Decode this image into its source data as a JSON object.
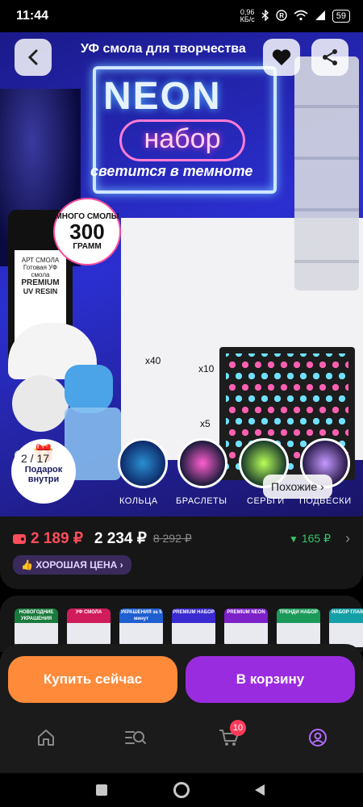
{
  "status_bar": {
    "time": "11:44",
    "net_speed_value": "0,96",
    "net_speed_unit": "КБ/с",
    "battery": "59",
    "icons": [
      "bluetooth-icon",
      "registered-icon",
      "wifi-icon",
      "signal-icon",
      "battery-icon"
    ]
  },
  "hero": {
    "title": "УФ смола для творчества",
    "neon_word": "NEON",
    "nabor_word": "набор",
    "glows_text": "светится в темноте",
    "bottle_label_top": "АРТ СМОЛА",
    "bottle_label_lines": [
      "Готовая УФ смола",
      "PREMIUM",
      "UV RESIN"
    ],
    "badge_top": "МНОГО СМОЛЫ",
    "badge_number": "300",
    "badge_unit": "ГРАММ",
    "counts": [
      "x40",
      "x10",
      "x5"
    ],
    "captions": [
      "КОЛЬЦА",
      "БРАСЛЕТЫ",
      "СЕРЬГИ",
      "ПОДВЕСКИ"
    ],
    "gift_text": "Подарок внутри",
    "image_counter": "2 / 17",
    "similar_label": "Похожие ›"
  },
  "price": {
    "card_price": "2 189 ₽",
    "price": "2 234 ₽",
    "old_price": "8 292 ₽",
    "cashback": "165 ₽",
    "good_price_label": "ХОРОШАЯ ЦЕНА ›"
  },
  "variants": [
    {
      "label": "НОВОГОДНИЕ УКРАШЕНИЯ",
      "color": "#1a7a3c"
    },
    {
      "label": "УФ СМОЛА",
      "color": "#d01c5b"
    },
    {
      "label": "УКРАШЕНИЯ за 5 минут",
      "color": "#1f5fcf"
    },
    {
      "label": "PREMIUM НАБОР",
      "color": "#3a2ad0"
    },
    {
      "label": "PREMIUM NEON",
      "color": "#7c22c8"
    },
    {
      "label": "ТРЕНДИ НАБОР",
      "color": "#1c9a5a"
    },
    {
      "label": "НАБОР ГЛАМУР",
      "color": "#15a0a8"
    }
  ],
  "actions": {
    "buy_now": "Купить сейчас",
    "add_to_cart": "В корзину"
  },
  "tabbar": {
    "cart_count": "10",
    "accent": "#9a2ce0"
  }
}
